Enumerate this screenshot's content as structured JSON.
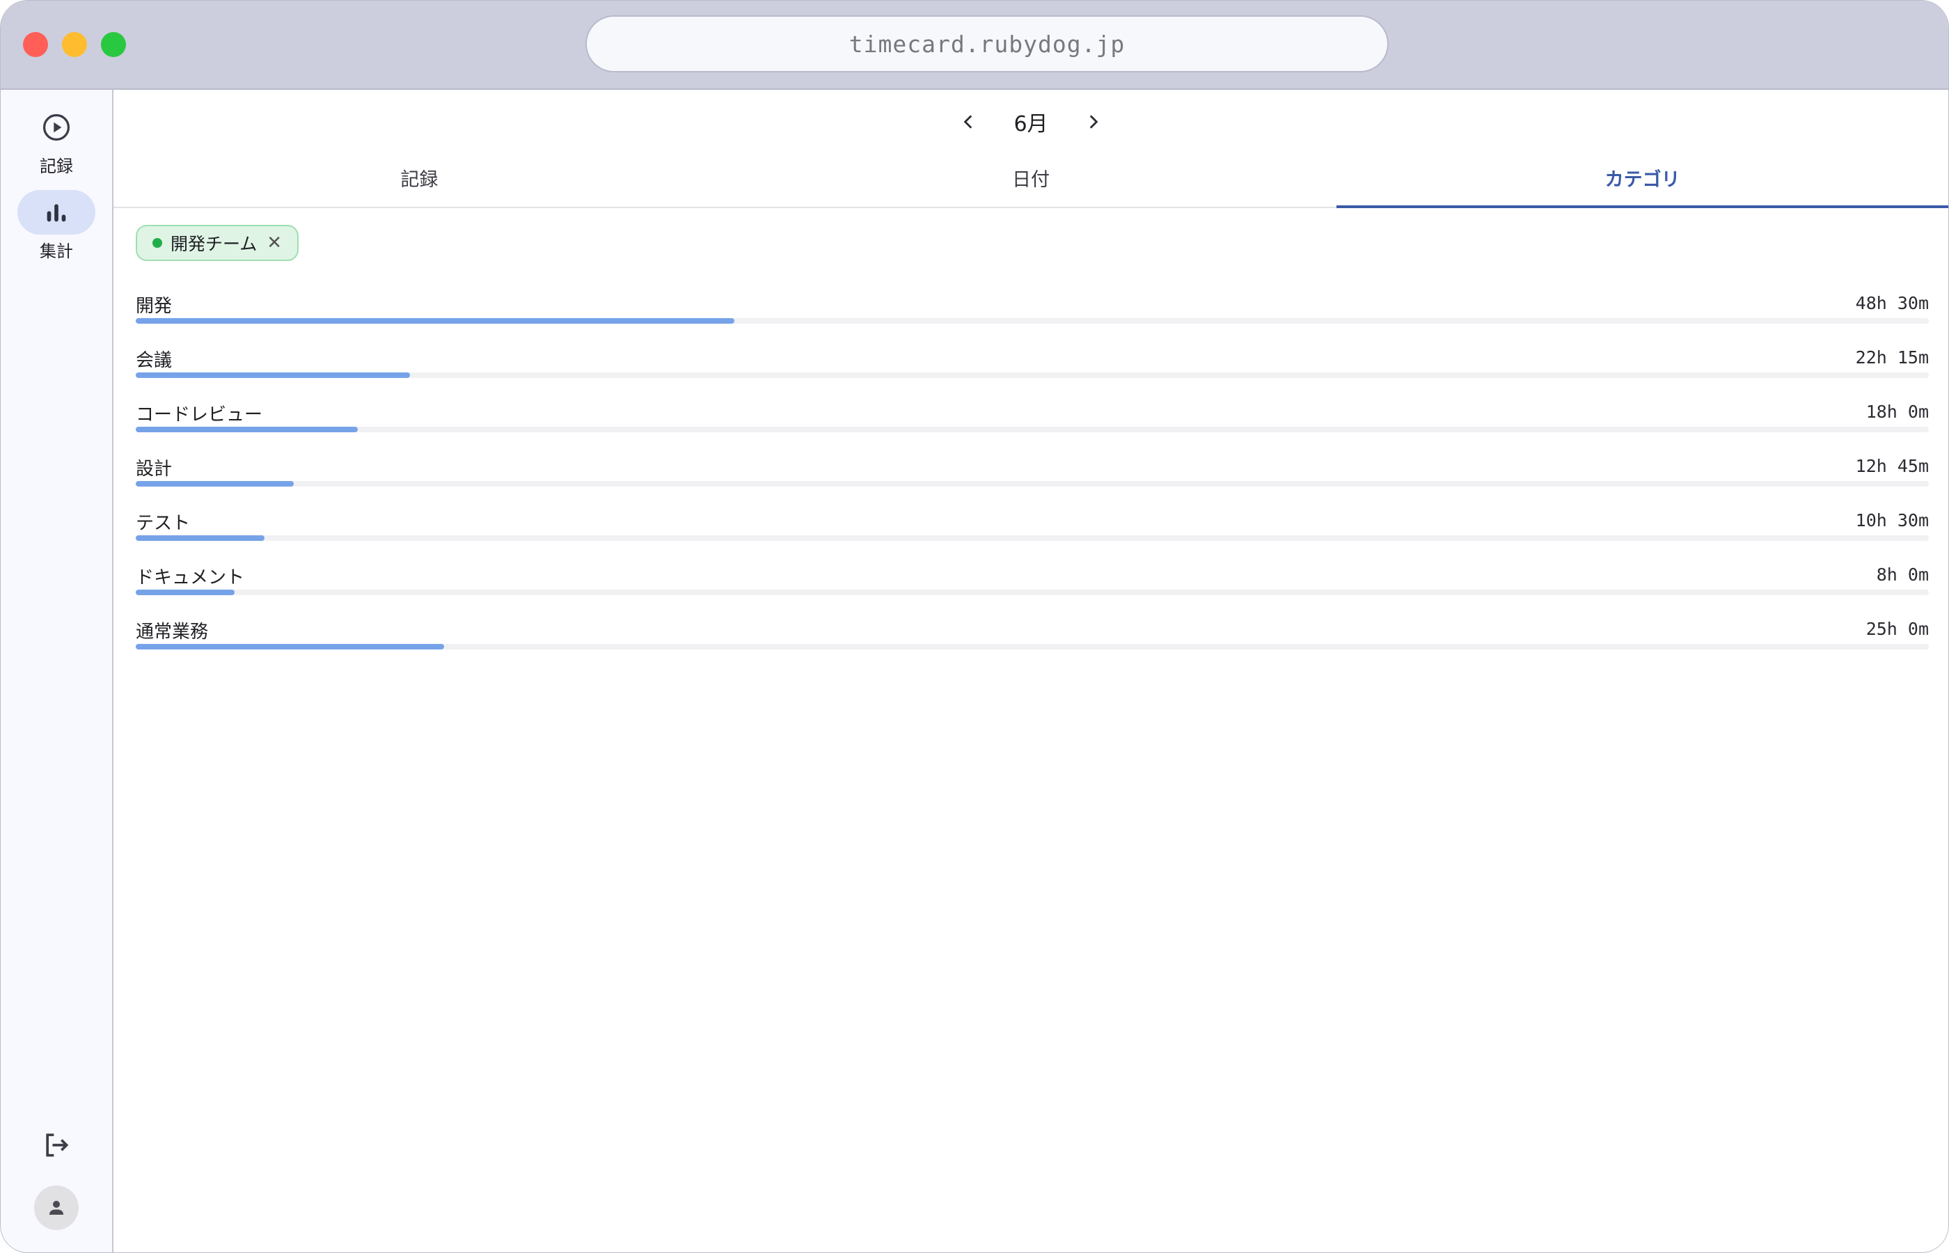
{
  "browser": {
    "url": "timecard.rubydog.jp"
  },
  "sidebar": {
    "items": [
      {
        "label": "記録",
        "icon": "play-circle-icon",
        "active": false
      },
      {
        "label": "集計",
        "icon": "bar-chart-icon",
        "active": true
      }
    ],
    "bottom": [
      {
        "icon": "logout-icon"
      },
      {
        "icon": "user-avatar-icon"
      }
    ]
  },
  "header": {
    "month": "6月"
  },
  "tabs": [
    {
      "label": "記録",
      "active": false
    },
    {
      "label": "日付",
      "active": false
    },
    {
      "label": "カテゴリ",
      "active": true
    }
  ],
  "filter": {
    "label": "開発チーム",
    "color": "#1fae4b"
  },
  "categories": [
    {
      "name": "開発",
      "time": "48h 30m",
      "fraction": 0.334
    },
    {
      "name": "会議",
      "time": "22h 15m",
      "fraction": 0.153
    },
    {
      "name": "コードレビュー",
      "time": "18h 0m",
      "fraction": 0.124
    },
    {
      "name": "設計",
      "time": "12h 45m",
      "fraction": 0.088
    },
    {
      "name": "テスト",
      "time": "10h 30m",
      "fraction": 0.072
    },
    {
      "name": "ドキュメント",
      "time": "8h 0m",
      "fraction": 0.055
    },
    {
      "name": "通常業務",
      "time": "25h 0m",
      "fraction": 0.172
    }
  ],
  "colors": {
    "accent": "#3a5aa8",
    "bar": "#76a3e8"
  }
}
